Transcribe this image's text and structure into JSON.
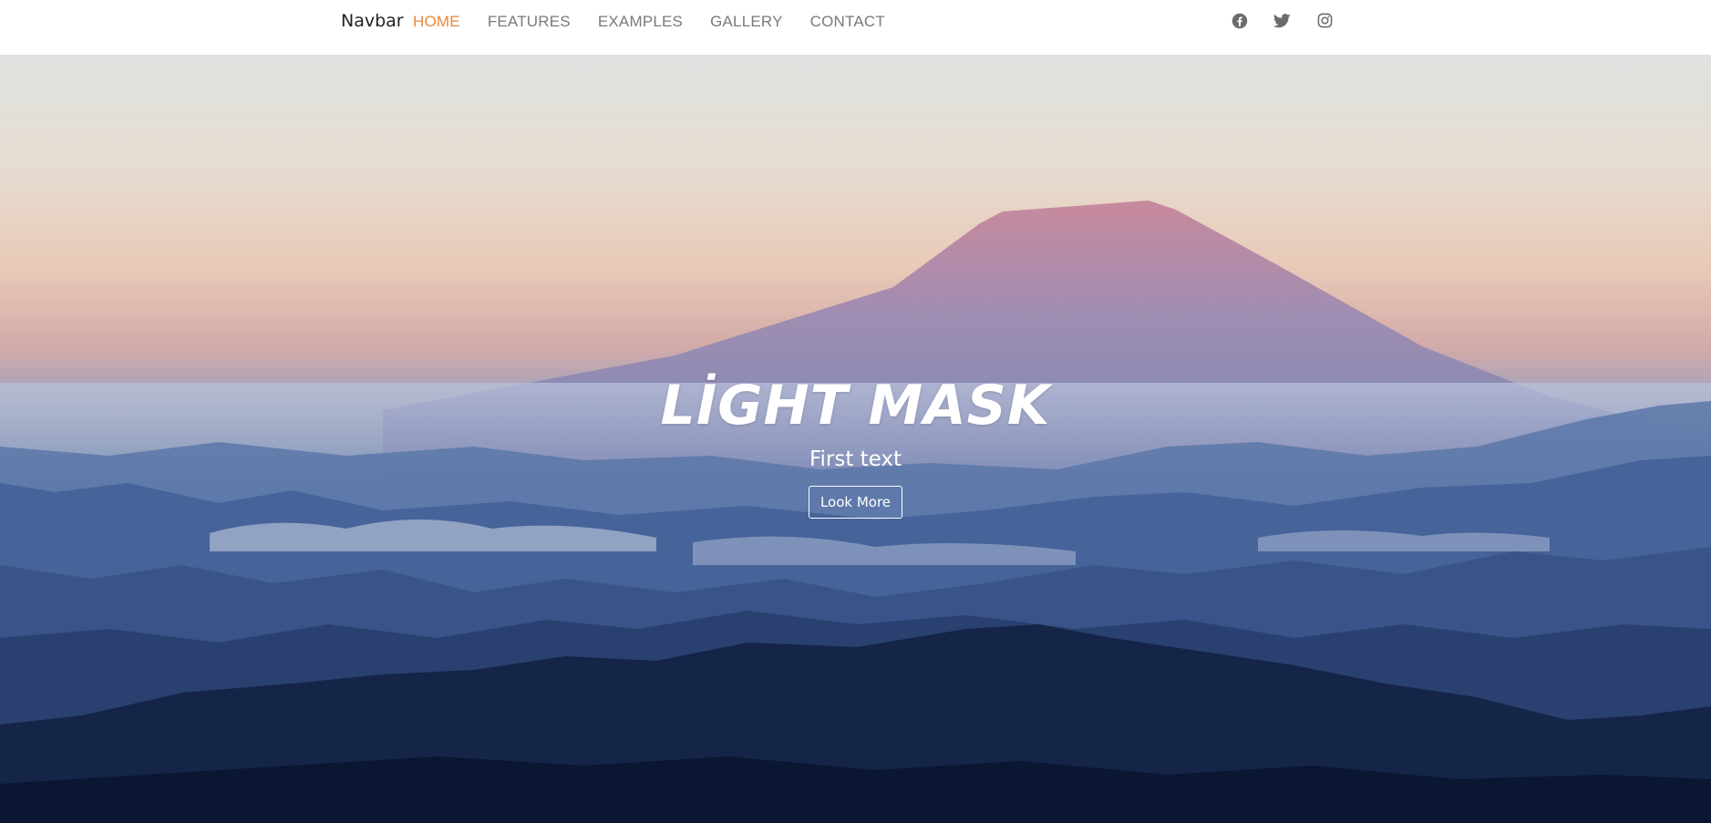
{
  "navbar": {
    "brand": "Navbar",
    "links": [
      {
        "label": "HOME",
        "active": true
      },
      {
        "label": "FEATURES",
        "active": false
      },
      {
        "label": "EXAMPLES",
        "active": false
      },
      {
        "label": "GALLERY",
        "active": false
      },
      {
        "label": "CONTACT",
        "active": false
      }
    ],
    "social": [
      "facebook-icon",
      "twitter-icon",
      "instagram-icon"
    ]
  },
  "hero": {
    "title": "LİGHT MASK",
    "subtitle": "First text",
    "button_label": "Look More"
  },
  "colors": {
    "accent": "#e8893a",
    "nav_text": "#7a7a7a",
    "icon": "#6c6c6c"
  }
}
